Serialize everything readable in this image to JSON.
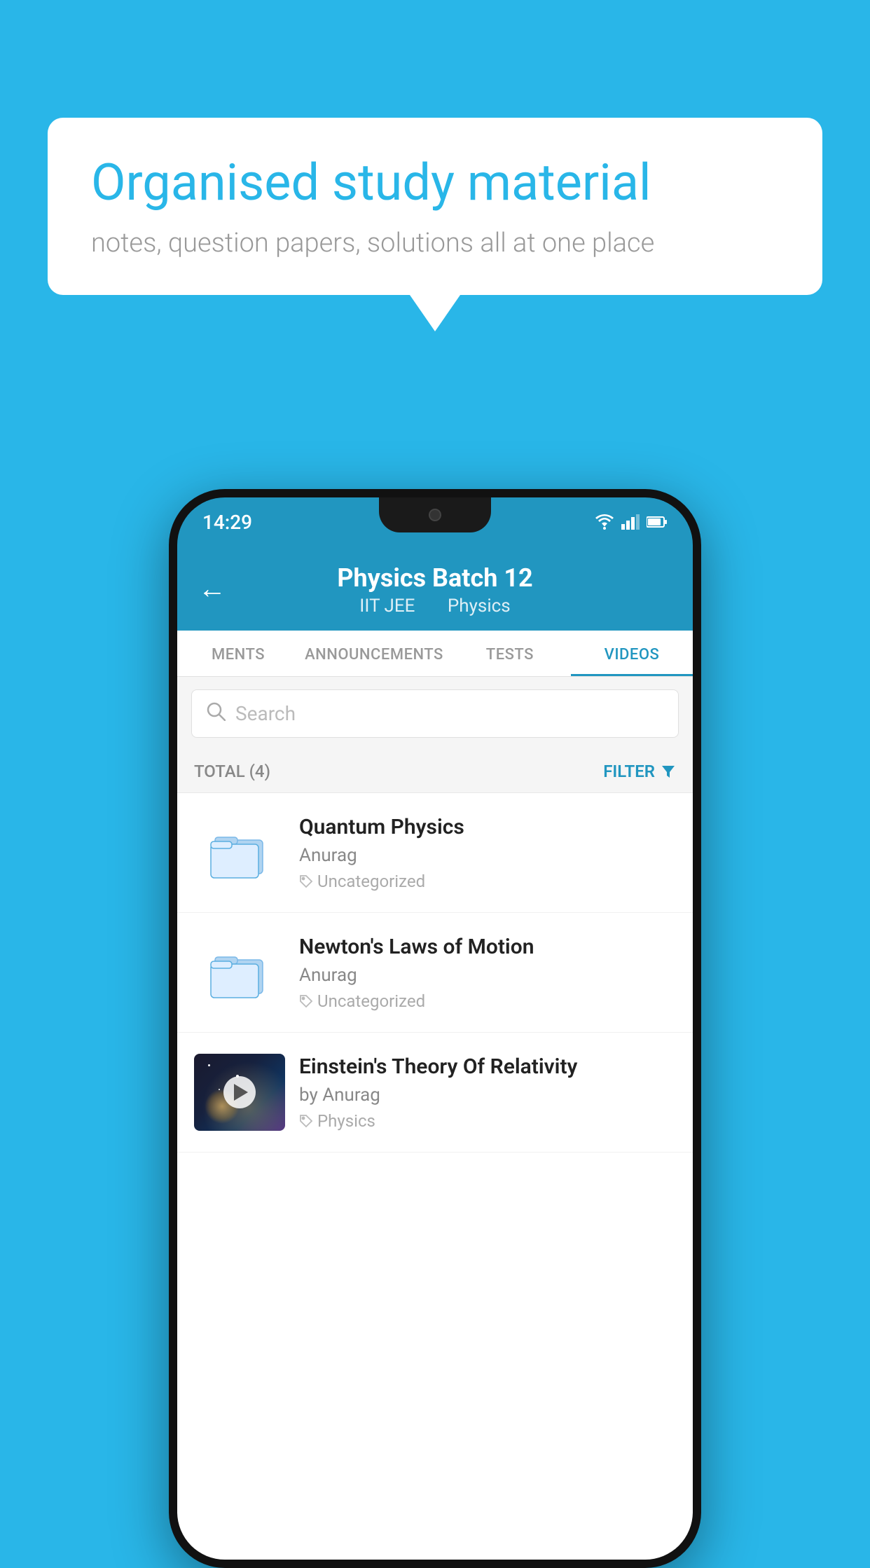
{
  "background_color": "#29b6e8",
  "speech_bubble": {
    "title": "Organised study material",
    "subtitle": "notes, question papers, solutions all at one place"
  },
  "status_bar": {
    "time": "14:29",
    "icons": [
      "wifi",
      "signal",
      "battery"
    ]
  },
  "header": {
    "back_label": "←",
    "title": "Physics Batch 12",
    "subtitle_part1": "IIT JEE",
    "subtitle_part2": "Physics"
  },
  "tabs": [
    {
      "label": "MENTS",
      "active": false
    },
    {
      "label": "ANNOUNCEMENTS",
      "active": false
    },
    {
      "label": "TESTS",
      "active": false
    },
    {
      "label": "VIDEOS",
      "active": true
    }
  ],
  "search": {
    "placeholder": "Search"
  },
  "filter_row": {
    "total_label": "TOTAL (4)",
    "filter_label": "FILTER"
  },
  "videos": [
    {
      "id": 1,
      "title": "Quantum Physics",
      "author": "Anurag",
      "tag": "Uncategorized",
      "type": "folder"
    },
    {
      "id": 2,
      "title": "Newton's Laws of Motion",
      "author": "Anurag",
      "tag": "Uncategorized",
      "type": "folder"
    },
    {
      "id": 3,
      "title": "Einstein's Theory Of Relativity",
      "author": "by Anurag",
      "tag": "Physics",
      "type": "video"
    }
  ]
}
